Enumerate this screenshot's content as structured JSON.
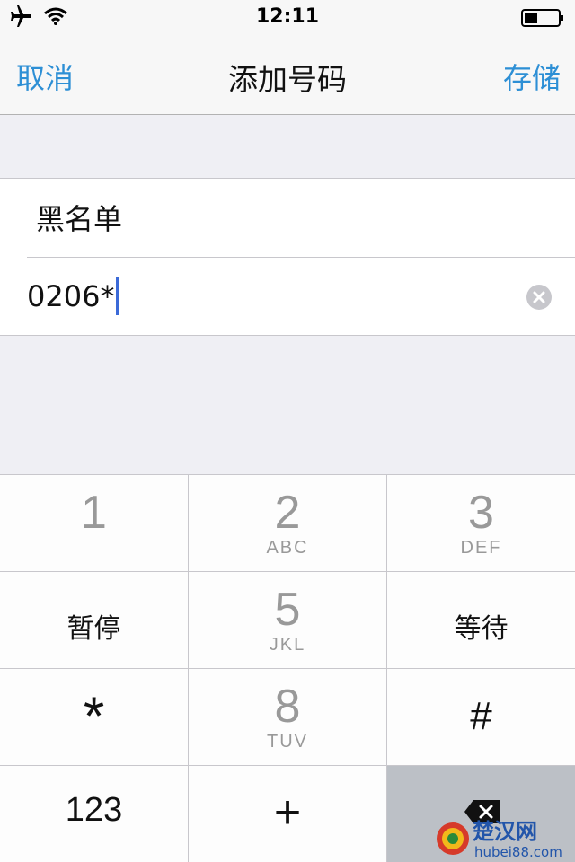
{
  "status_bar": {
    "time": "12:11",
    "icons": [
      "airplane-icon",
      "wifi-icon",
      "battery-icon"
    ]
  },
  "nav": {
    "cancel_label": "取消",
    "title": "添加号码",
    "save_label": "存储",
    "accent_color": "#2d8fd5"
  },
  "form": {
    "name_value": "黑名单",
    "number_value": "0206*"
  },
  "keypad": {
    "key_1": {
      "digit": "1",
      "letters": ""
    },
    "key_2": {
      "digit": "2",
      "letters": "ABC"
    },
    "key_3": {
      "digit": "3",
      "letters": "DEF"
    },
    "key_pause": {
      "label": "暂停"
    },
    "key_5": {
      "digit": "5",
      "letters": "JKL"
    },
    "key_wait": {
      "label": "等待"
    },
    "key_star": {
      "label": "*"
    },
    "key_8": {
      "digit": "8",
      "letters": "TUV"
    },
    "key_hash": {
      "label": "#"
    },
    "key_123": {
      "label": "123"
    },
    "key_plus": {
      "label": "+"
    }
  },
  "watermark": {
    "brand": "楚汉网",
    "domain": "hubei88.com"
  }
}
